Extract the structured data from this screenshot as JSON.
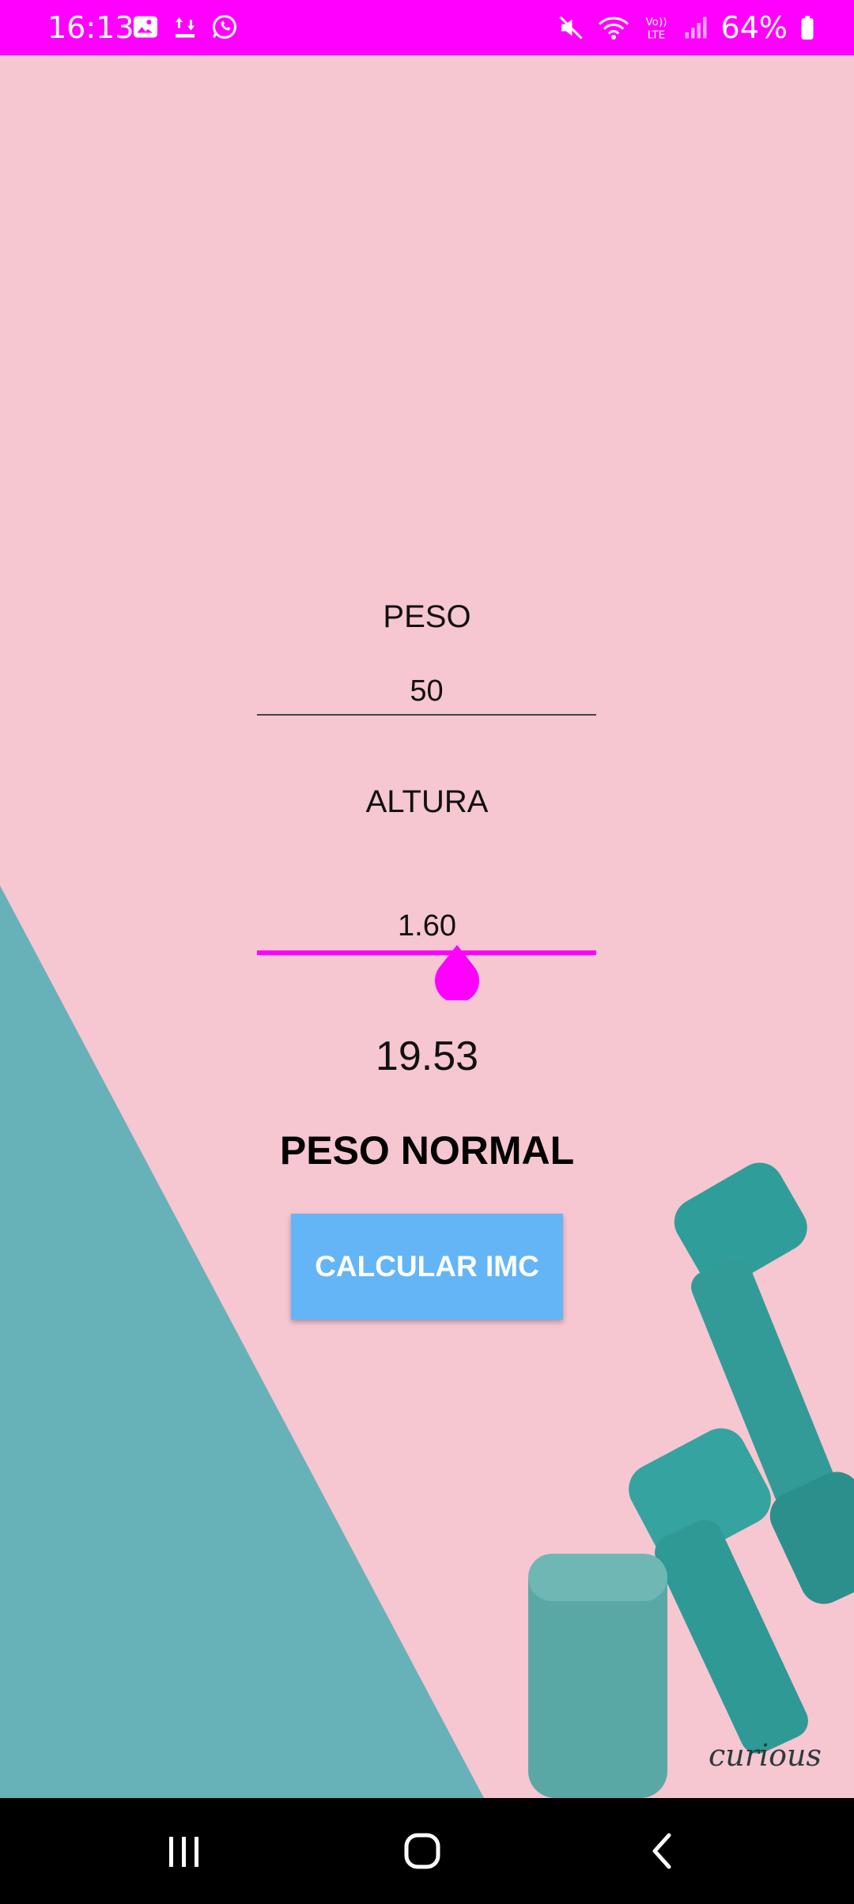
{
  "status_bar": {
    "time": "16:13",
    "battery": "64%",
    "icons_left": [
      "gallery-icon",
      "transfer-icon",
      "whatsapp-icon"
    ],
    "icons_right": [
      "mute-icon",
      "wifi-icon",
      "volte-icon",
      "signal-icon",
      "battery-icon"
    ],
    "volte_label": "Vo))\nLTE",
    "color": "#ff00ff"
  },
  "form": {
    "peso_label": "PESO",
    "peso_value": "50",
    "altura_label": "ALTURA",
    "altura_value": "1.60",
    "altura_slider_fraction": 0.59
  },
  "result": {
    "imc": "19.53",
    "status": "PESO NORMAL"
  },
  "actions": {
    "calculate_label": "CALCULAR IMC"
  },
  "background": {
    "watermark": "curious"
  },
  "nav_bar": {
    "buttons": [
      "recents-icon",
      "home-icon",
      "back-icon"
    ]
  },
  "colors": {
    "accent": "#ff00ff",
    "background": "#f6c6d1",
    "teal": "#67b2b9",
    "button": "#64b5f6"
  }
}
